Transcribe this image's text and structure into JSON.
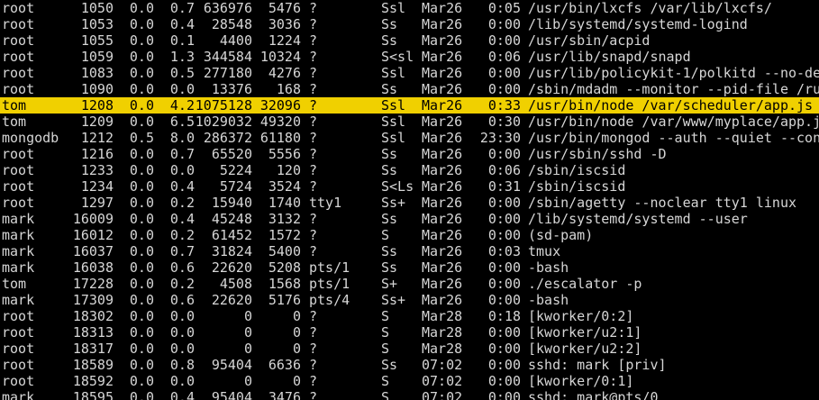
{
  "terminal": {
    "background": "#000000",
    "foreground": "#d6d6d6",
    "highlight_color": "#f0d000",
    "selected_row_index": 6,
    "rows": [
      {
        "user": "root",
        "pid": "1050",
        "cpu": "0.0",
        "mem": "0.7",
        "vsz": "636976",
        "rss": "5476",
        "tty": "?",
        "stat": "Ssl",
        "start": "Mar26",
        "time": "0:05",
        "cmd": "/usr/bin/lxcfs /var/lib/lxcfs/"
      },
      {
        "user": "root",
        "pid": "1053",
        "cpu": "0.0",
        "mem": "0.4",
        "vsz": "28548",
        "rss": "3036",
        "tty": "?",
        "stat": "Ss",
        "start": "Mar26",
        "time": "0:00",
        "cmd": "/lib/systemd/systemd-logind"
      },
      {
        "user": "root",
        "pid": "1055",
        "cpu": "0.0",
        "mem": "0.1",
        "vsz": "4400",
        "rss": "1224",
        "tty": "?",
        "stat": "Ss",
        "start": "Mar26",
        "time": "0:00",
        "cmd": "/usr/sbin/acpid"
      },
      {
        "user": "root",
        "pid": "1059",
        "cpu": "0.0",
        "mem": "1.3",
        "vsz": "344584",
        "rss": "10324",
        "tty": "?",
        "stat": "S<sl",
        "start": "Mar26",
        "time": "0:06",
        "cmd": "/usr/lib/snapd/snapd"
      },
      {
        "user": "root",
        "pid": "1083",
        "cpu": "0.0",
        "mem": "0.5",
        "vsz": "277180",
        "rss": "4276",
        "tty": "?",
        "stat": "Ssl",
        "start": "Mar26",
        "time": "0:00",
        "cmd": "/usr/lib/policykit-1/polkitd --no-de"
      },
      {
        "user": "root",
        "pid": "1090",
        "cpu": "0.0",
        "mem": "0.0",
        "vsz": "13376",
        "rss": "168",
        "tty": "?",
        "stat": "Ss",
        "start": "Mar26",
        "time": "0:00",
        "cmd": "/sbin/mdadm --monitor --pid-file /ru"
      },
      {
        "user": "tom",
        "pid": "1208",
        "cpu": "0.0",
        "mem": "4.2",
        "vsz": "1075128",
        "rss": "32096",
        "tty": "?",
        "stat": "Ssl",
        "start": "Mar26",
        "time": "0:33",
        "cmd": "/usr/bin/node /var/scheduler/app.js"
      },
      {
        "user": "tom",
        "pid": "1209",
        "cpu": "0.0",
        "mem": "6.5",
        "vsz": "1029032",
        "rss": "49320",
        "tty": "?",
        "stat": "Ssl",
        "start": "Mar26",
        "time": "0:30",
        "cmd": "/usr/bin/node /var/www/myplace/app.j"
      },
      {
        "user": "mongodb",
        "pid": "1212",
        "cpu": "0.5",
        "mem": "8.0",
        "vsz": "286372",
        "rss": "61180",
        "tty": "?",
        "stat": "Ssl",
        "start": "Mar26",
        "time": "23:30",
        "cmd": "/usr/bin/mongod --auth --quiet --con"
      },
      {
        "user": "root",
        "pid": "1216",
        "cpu": "0.0",
        "mem": "0.7",
        "vsz": "65520",
        "rss": "5556",
        "tty": "?",
        "stat": "Ss",
        "start": "Mar26",
        "time": "0:00",
        "cmd": "/usr/sbin/sshd -D"
      },
      {
        "user": "root",
        "pid": "1233",
        "cpu": "0.0",
        "mem": "0.0",
        "vsz": "5224",
        "rss": "120",
        "tty": "?",
        "stat": "Ss",
        "start": "Mar26",
        "time": "0:06",
        "cmd": "/sbin/iscsid"
      },
      {
        "user": "root",
        "pid": "1234",
        "cpu": "0.0",
        "mem": "0.4",
        "vsz": "5724",
        "rss": "3524",
        "tty": "?",
        "stat": "S<Ls",
        "start": "Mar26",
        "time": "0:31",
        "cmd": "/sbin/iscsid"
      },
      {
        "user": "root",
        "pid": "1297",
        "cpu": "0.0",
        "mem": "0.2",
        "vsz": "15940",
        "rss": "1740",
        "tty": "tty1",
        "stat": "Ss+",
        "start": "Mar26",
        "time": "0:00",
        "cmd": "/sbin/agetty --noclear tty1 linux"
      },
      {
        "user": "mark",
        "pid": "16009",
        "cpu": "0.0",
        "mem": "0.4",
        "vsz": "45248",
        "rss": "3132",
        "tty": "?",
        "stat": "Ss",
        "start": "Mar26",
        "time": "0:00",
        "cmd": "/lib/systemd/systemd --user"
      },
      {
        "user": "mark",
        "pid": "16012",
        "cpu": "0.0",
        "mem": "0.2",
        "vsz": "61452",
        "rss": "1572",
        "tty": "?",
        "stat": "S",
        "start": "Mar26",
        "time": "0:00",
        "cmd": "(sd-pam)"
      },
      {
        "user": "mark",
        "pid": "16037",
        "cpu": "0.0",
        "mem": "0.7",
        "vsz": "31824",
        "rss": "5400",
        "tty": "?",
        "stat": "Ss",
        "start": "Mar26",
        "time": "0:03",
        "cmd": "tmux"
      },
      {
        "user": "mark",
        "pid": "16038",
        "cpu": "0.0",
        "mem": "0.6",
        "vsz": "22620",
        "rss": "5208",
        "tty": "pts/1",
        "stat": "Ss",
        "start": "Mar26",
        "time": "0:00",
        "cmd": "-bash"
      },
      {
        "user": "tom",
        "pid": "17228",
        "cpu": "0.0",
        "mem": "0.2",
        "vsz": "4508",
        "rss": "1568",
        "tty": "pts/1",
        "stat": "S+",
        "start": "Mar26",
        "time": "0:00",
        "cmd": "./escalator -p"
      },
      {
        "user": "mark",
        "pid": "17309",
        "cpu": "0.0",
        "mem": "0.6",
        "vsz": "22620",
        "rss": "5176",
        "tty": "pts/4",
        "stat": "Ss+",
        "start": "Mar26",
        "time": "0:00",
        "cmd": "-bash"
      },
      {
        "user": "root",
        "pid": "18302",
        "cpu": "0.0",
        "mem": "0.0",
        "vsz": "0",
        "rss": "0",
        "tty": "?",
        "stat": "S",
        "start": "Mar28",
        "time": "0:18",
        "cmd": "[kworker/0:2]"
      },
      {
        "user": "root",
        "pid": "18313",
        "cpu": "0.0",
        "mem": "0.0",
        "vsz": "0",
        "rss": "0",
        "tty": "?",
        "stat": "S",
        "start": "Mar28",
        "time": "0:00",
        "cmd": "[kworker/u2:1]"
      },
      {
        "user": "root",
        "pid": "18317",
        "cpu": "0.0",
        "mem": "0.0",
        "vsz": "0",
        "rss": "0",
        "tty": "?",
        "stat": "S",
        "start": "Mar28",
        "time": "0:00",
        "cmd": "[kworker/u2:2]"
      },
      {
        "user": "root",
        "pid": "18589",
        "cpu": "0.0",
        "mem": "0.8",
        "vsz": "95404",
        "rss": "6636",
        "tty": "?",
        "stat": "Ss",
        "start": "07:02",
        "time": "0:00",
        "cmd": "sshd: mark [priv]"
      },
      {
        "user": "root",
        "pid": "18592",
        "cpu": "0.0",
        "mem": "0.0",
        "vsz": "0",
        "rss": "0",
        "tty": "?",
        "stat": "S",
        "start": "07:02",
        "time": "0:00",
        "cmd": "[kworker/0:1]"
      },
      {
        "user": "mark",
        "pid": "18595",
        "cpu": "0.0",
        "mem": "0.4",
        "vsz": "95404",
        "rss": "3476",
        "tty": "?",
        "stat": "S",
        "start": "07:02",
        "time": "0:00",
        "cmd": "sshd: mark@pts/0"
      }
    ]
  }
}
